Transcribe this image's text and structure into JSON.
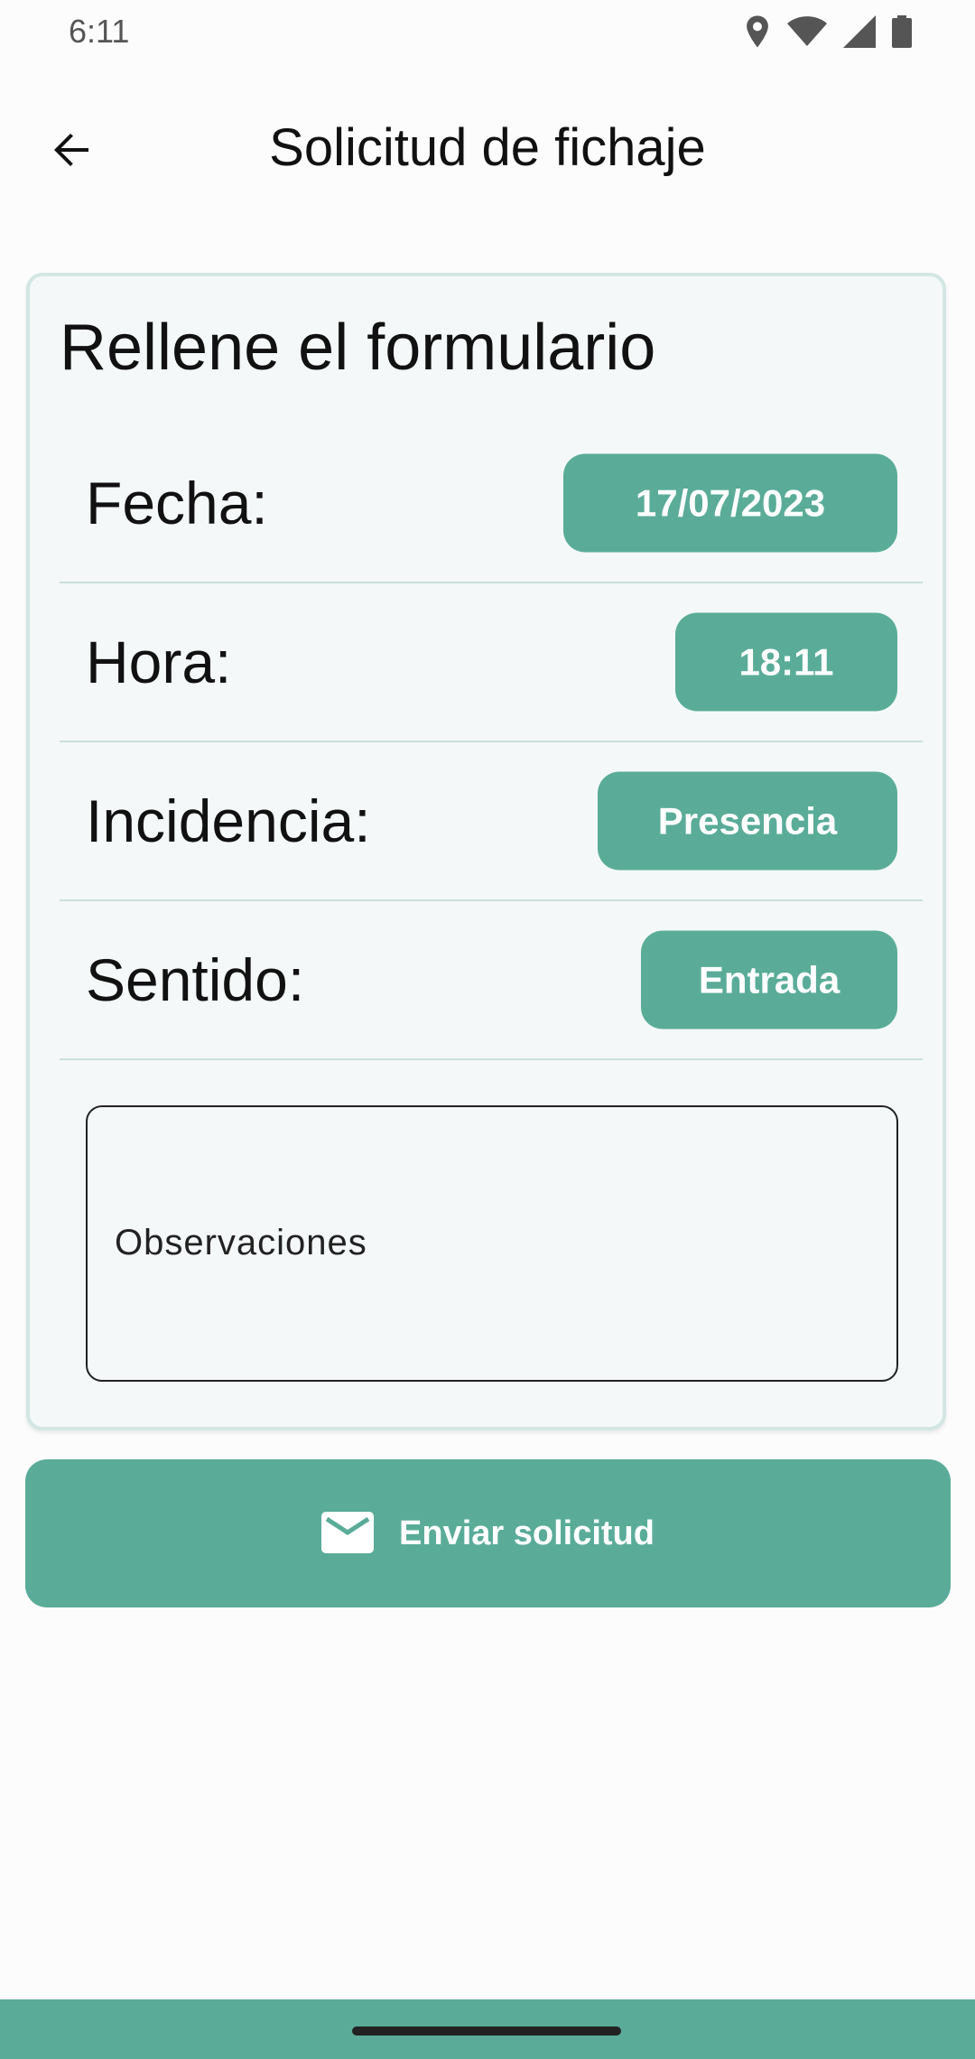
{
  "status_bar": {
    "time": "6:11",
    "icons": [
      "location-icon",
      "wifi-icon",
      "signal-icon",
      "battery-icon"
    ]
  },
  "app_bar": {
    "title": "Solicitud de fichaje",
    "back_icon": "arrow-back-icon"
  },
  "form": {
    "heading": "Rellene el formulario",
    "fecha": {
      "label": "Fecha:",
      "value": "17/07/2023"
    },
    "hora": {
      "label": "Hora:",
      "value": "18:11"
    },
    "incidencia": {
      "label": "Incidencia:",
      "value": "Presencia"
    },
    "sentido": {
      "label": "Sentido:",
      "value": "Entrada"
    },
    "observaciones": {
      "placeholder": "Observaciones",
      "value": ""
    }
  },
  "send_button": {
    "label": "Enviar solicitud",
    "icon": "mail-icon"
  },
  "colors": {
    "accent": "#5aac98",
    "card_background": "#f4f8f9",
    "card_border": "#d3e6e3"
  }
}
